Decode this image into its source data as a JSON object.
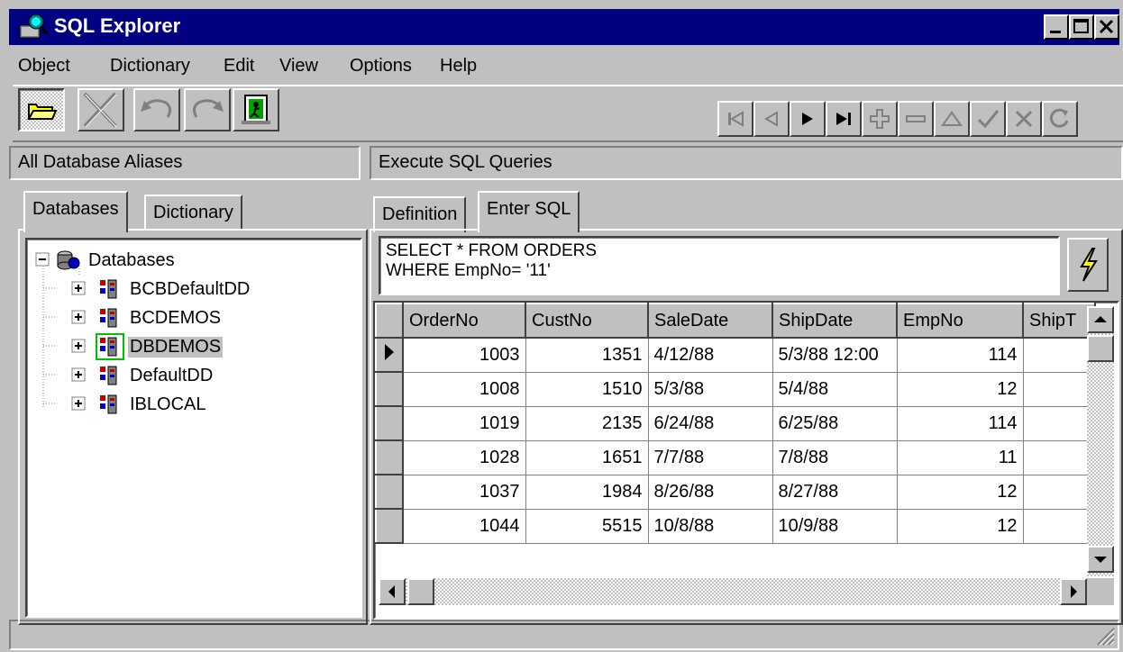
{
  "window": {
    "title": "SQL Explorer"
  },
  "menu": [
    "Object",
    "Dictionary",
    "Edit",
    "View",
    "Options",
    "Help"
  ],
  "left_panel": {
    "header": "All Database Aliases",
    "tabs": [
      "Databases",
      "Dictionary"
    ],
    "tree": {
      "root": "Databases",
      "items": [
        "BCBDefaultDD",
        "BCDEMOS",
        "DBDEMOS",
        "DefaultDD",
        "IBLOCAL"
      ],
      "selected": "DBDEMOS"
    }
  },
  "right_panel": {
    "header": "Execute SQL Queries",
    "tabs": [
      "Definition",
      "Enter SQL"
    ],
    "active_tab": "Enter SQL",
    "sql_lines": [
      "SELECT * FROM ORDERS",
      "WHERE EmpNo= '11'"
    ],
    "grid": {
      "columns": [
        "OrderNo",
        "CustNo",
        "SaleDate",
        "ShipDate",
        "EmpNo",
        "ShipT"
      ],
      "rows": [
        [
          "1003",
          "1351",
          "4/12/88",
          "5/3/88 12:00",
          "114",
          ""
        ],
        [
          "1008",
          "1510",
          "5/3/88",
          "5/4/88",
          "12",
          ""
        ],
        [
          "1019",
          "2135",
          "6/24/88",
          "6/25/88",
          "114",
          ""
        ],
        [
          "1028",
          "1651",
          "7/7/88",
          "7/8/88",
          "11",
          ""
        ],
        [
          "1037",
          "1984",
          "8/26/88",
          "8/27/88",
          "12",
          ""
        ],
        [
          "1044",
          "5515",
          "10/8/88",
          "10/9/88",
          "12",
          ""
        ]
      ]
    }
  },
  "status": {
    "text": ""
  }
}
